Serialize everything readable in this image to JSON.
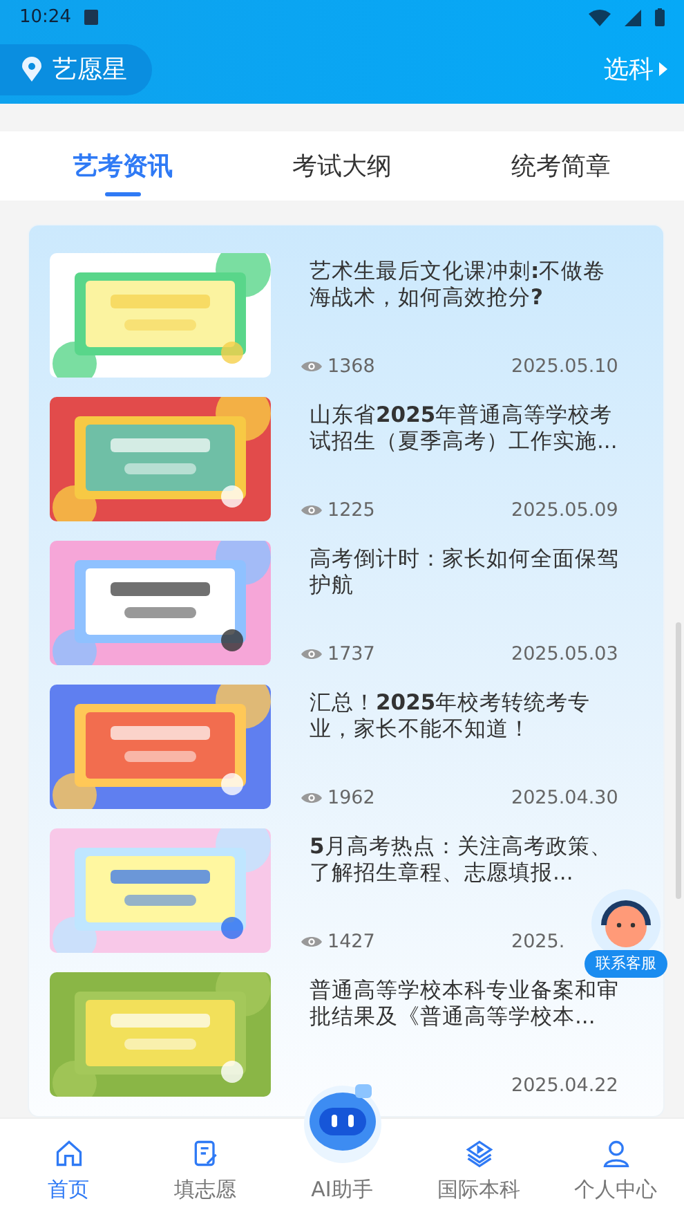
{
  "status_bar": {
    "time": "10:24"
  },
  "header": {
    "location": "艺愿星",
    "action": "选科"
  },
  "tabs": [
    {
      "label": "艺考资讯",
      "selected": true
    },
    {
      "label": "考试大纲",
      "selected": false
    },
    {
      "label": "统考简章",
      "selected": false
    }
  ],
  "articles": [
    {
      "title": "艺术生最后文化课冲刺**:**不做卷海战术，如何高效抢分**?**",
      "views": "1368",
      "date": "2025.05.10"
    },
    {
      "title": "山东省**2025**年普通高等学校考试招生（夏季高考）工作实施...",
      "views": "1225",
      "date": "2025.05.09"
    },
    {
      "title": "高考倒计时：家长如何全面保驾护航",
      "views": "1737",
      "date": "2025.05.03"
    },
    {
      "title": "汇总！**2025**年校考转统考专业，家长不能不知道！",
      "views": "1962",
      "date": "2025.04.30"
    },
    {
      "title": "**5**月高考热点：关注高考政策、了解招生章程、志愿填报...",
      "views": "1427",
      "date": "2025."
    },
    {
      "title": "普通高等学校本科专业备案和审批结果及《普通高等学校本...",
      "date": "2025.04.22"
    }
  ],
  "support_button": {
    "label": "联系客服"
  },
  "nav": [
    {
      "kind": "home",
      "label": "首页",
      "selected": true
    },
    {
      "kind": "form",
      "label": "填志愿",
      "selected": false
    },
    {
      "kind": "robot",
      "label": "AI助手",
      "selected": false
    },
    {
      "kind": "layers",
      "label": "国际本科",
      "selected": false
    },
    {
      "kind": "user",
      "label": "个人中心",
      "selected": false
    }
  ]
}
